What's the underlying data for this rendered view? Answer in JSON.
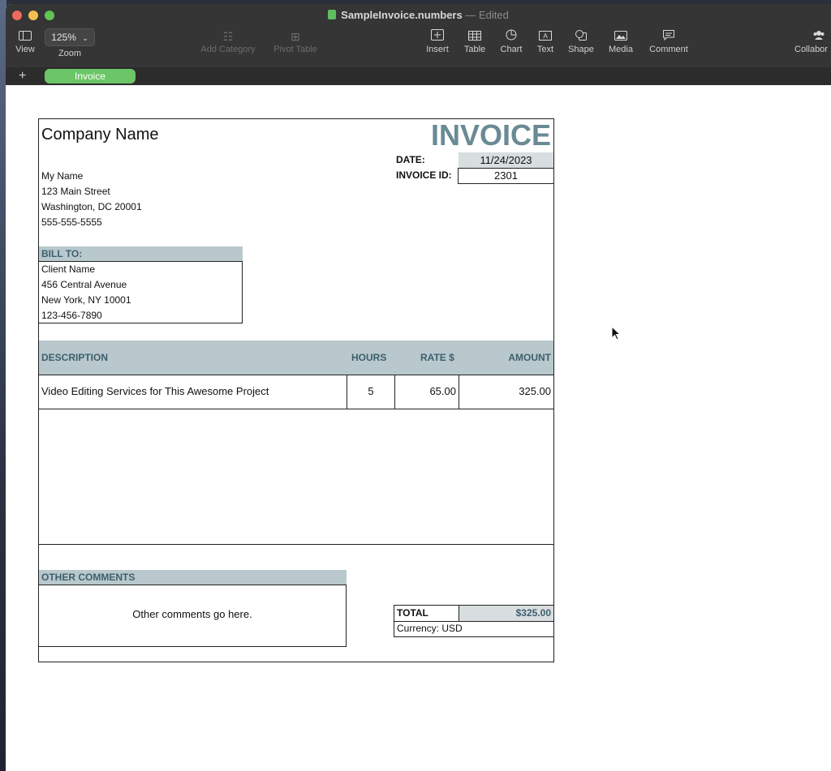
{
  "window": {
    "filename": "SampleInvoice.numbers",
    "separator": "—",
    "status": "Edited"
  },
  "toolbar": {
    "view_label": "View",
    "zoom_value": "125%",
    "zoom_label": "Zoom",
    "add_category_label": "Add Category",
    "pivot_table_label": "Pivot Table",
    "insert_label": "Insert",
    "table_label": "Table",
    "chart_label": "Chart",
    "text_label": "Text",
    "shape_label": "Shape",
    "media_label": "Media",
    "comment_label": "Comment",
    "collaborate_label": "Collabor"
  },
  "sheets": {
    "add": "+",
    "tabs": [
      {
        "label": "Invoice",
        "active": true
      }
    ]
  },
  "invoice": {
    "company_name": "Company Name",
    "title": "INVOICE",
    "date_label": "DATE:",
    "date_value": "11/24/2023",
    "invoice_id_label": "INVOICE ID:",
    "invoice_id_value": "2301",
    "sender": {
      "name": "My Name",
      "street": "123 Main Street",
      "city": "Washington, DC 20001",
      "phone": "555-555-5555"
    },
    "bill_to_label": "BILL TO:",
    "client": {
      "name": "Client Name",
      "street": "456 Central Avenue",
      "city": "New York, NY 10001",
      "phone": "123-456-7890"
    },
    "columns": {
      "description": "DESCRIPTION",
      "hours": "HOURS",
      "rate": "RATE $",
      "amount": "AMOUNT"
    },
    "line_items": [
      {
        "description": "Video Editing Services for This Awesome Project",
        "hours": "5",
        "rate": "65.00",
        "amount": "325.00"
      }
    ],
    "other_comments_label": "OTHER COMMENTS",
    "other_comments_text": "Other comments go here.",
    "total_label": "TOTAL",
    "total_value": "$325.00",
    "currency": "Currency: USD"
  },
  "colors": {
    "accent_header": "#b8c8cc",
    "title_text": "#6a8a95",
    "sheet_tab": "#6cc566",
    "titlebar": "#353535"
  }
}
